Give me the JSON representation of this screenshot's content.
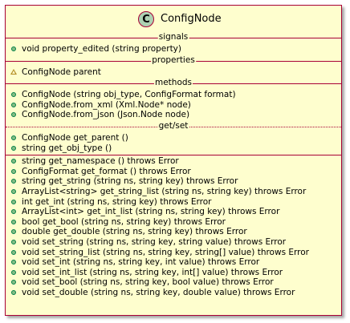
{
  "class": {
    "icon_letter": "C",
    "name": "ConfigNode",
    "colors": {
      "fill": "#FEFECE",
      "border": "#A80036",
      "icon_bg": "#ADD1B2"
    }
  },
  "sections": {
    "signals": {
      "label": "signals",
      "members": [
        "void property_edited (string property)"
      ]
    },
    "properties": {
      "label": "properties",
      "members": [
        "ConfigNode parent"
      ]
    },
    "methods": {
      "label": "methods",
      "members": [
        "ConfigNode (string obj_type, ConfigFormat format)",
        "ConfigNode.from_xml (Xml.Node* node)",
        "ConfigNode.from_json (Json.Node node)"
      ]
    },
    "getset": {
      "label": "get/set",
      "members": [
        "ConfigNode get_parent ()",
        "string get_obj_type ()"
      ]
    },
    "other": {
      "members": [
        "string get_namespace () throws Error",
        "ConfigFormat get_format () throws Error",
        "string get_string (string ns, string key) throws Error",
        "ArrayList<string> get_string_list (string ns, string key) throws Error",
        "int get_int (string ns, string key) throws Error",
        "ArrayList<int> get_int_list (string ns, string key) throws Error",
        "bool get_bool (string ns, string key) throws Error",
        "double get_double (string ns, string key) throws Error",
        "void set_string (string ns, string key, string value) throws Error",
        "void set_string_list (string ns, string key, string[] value) throws Error",
        "void set_int (string ns, string key, int value) throws Error",
        "void set_int_list (string ns, string key, int[] value) throws Error",
        "void set_bool (string ns, string key, bool value) throws Error",
        "void set_double (string ns, string key, double value) throws Error"
      ]
    }
  }
}
